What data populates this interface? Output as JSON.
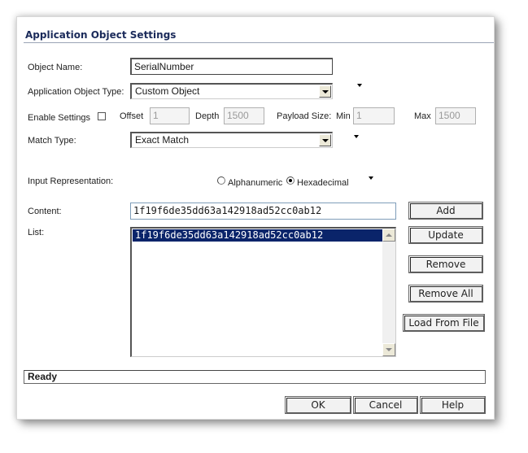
{
  "dialog": {
    "title": "Application Object Settings"
  },
  "form": {
    "object_name_label": "Object Name:",
    "object_name_value": "SerialNumber",
    "object_type_label": "Application Object Type:",
    "object_type_value": "Custom Object",
    "enable_settings_label": "Enable Settings",
    "offset_label": "Offset",
    "offset_value": "1",
    "depth_label": "Depth",
    "depth_value": "1500",
    "payload_size_label": "Payload Size:",
    "min_label": "Min",
    "min_value": "1",
    "max_label": "Max",
    "max_value": "1500",
    "match_type_label": "Match Type:",
    "match_type_value": "Exact Match",
    "input_rep_label": "Input Representation:",
    "radio_alphanumeric": "Alphanumeric",
    "radio_hexadecimal": "Hexadecimal",
    "selected_representation": "Hexadecimal",
    "content_label": "Content:",
    "content_value": "1f19f6de35dd63a142918ad52cc0ab12",
    "list_label": "List:",
    "list_items": [
      "1f19f6de35dd63a142918ad52cc0ab12"
    ]
  },
  "side_buttons": {
    "add": "Add",
    "update": "Update",
    "remove": "Remove",
    "remove_all": "Remove All",
    "load_from_file": "Load From File"
  },
  "status": {
    "text": "Ready"
  },
  "footer": {
    "ok": "OK",
    "cancel": "Cancel",
    "help": "Help"
  },
  "icons": {
    "dropdown": "chevron-down-icon",
    "scroll_up": "scroll-up-arrow-icon",
    "scroll_down": "scroll-down-arrow-icon"
  }
}
